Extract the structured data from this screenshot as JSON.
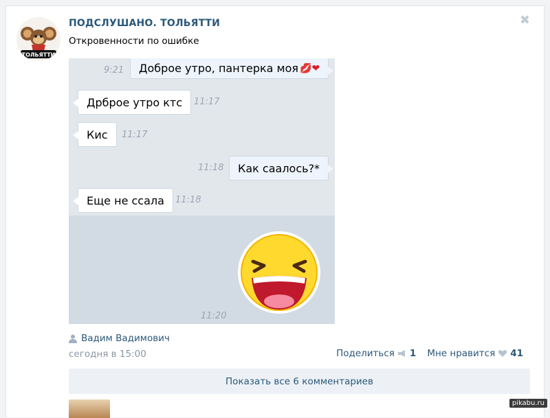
{
  "post": {
    "author": "ПОДСЛУШАНО. ТОЛЬЯТТИ",
    "avatar_text": "ТОЛЬЯТТИ",
    "text": "Откровенности по ошибке",
    "close_glyph": "✖"
  },
  "chat": {
    "messages": [
      {
        "dir": "out",
        "text": "Доброе утро, пантерка моя",
        "time": "9:21",
        "emoji": "💋❤"
      },
      {
        "dir": "in",
        "text": "Дрброе утро ктс",
        "time": "11:17"
      },
      {
        "dir": "in",
        "text": "Кис",
        "time": "11:17"
      },
      {
        "dir": "out",
        "text": "Как саалось?*",
        "time": "11:18"
      },
      {
        "dir": "in",
        "text": "Еще не ссала",
        "time": "11:18"
      }
    ],
    "sticker_time": "11:20"
  },
  "meta": {
    "signer": "Вадим Вадимович",
    "date": "сегодня в 15:00"
  },
  "actions": {
    "share_label": "Поделиться",
    "share_count": "1",
    "like_label": "Мне нравится",
    "like_count": "41"
  },
  "comments": {
    "show_all": "Показать все 6 комментариев"
  },
  "watermark": "pikabu.ru",
  "colors": {
    "link": "#2b587a",
    "chat_bg": "#e2e7ec",
    "out_bubble": "#edf4fb"
  }
}
